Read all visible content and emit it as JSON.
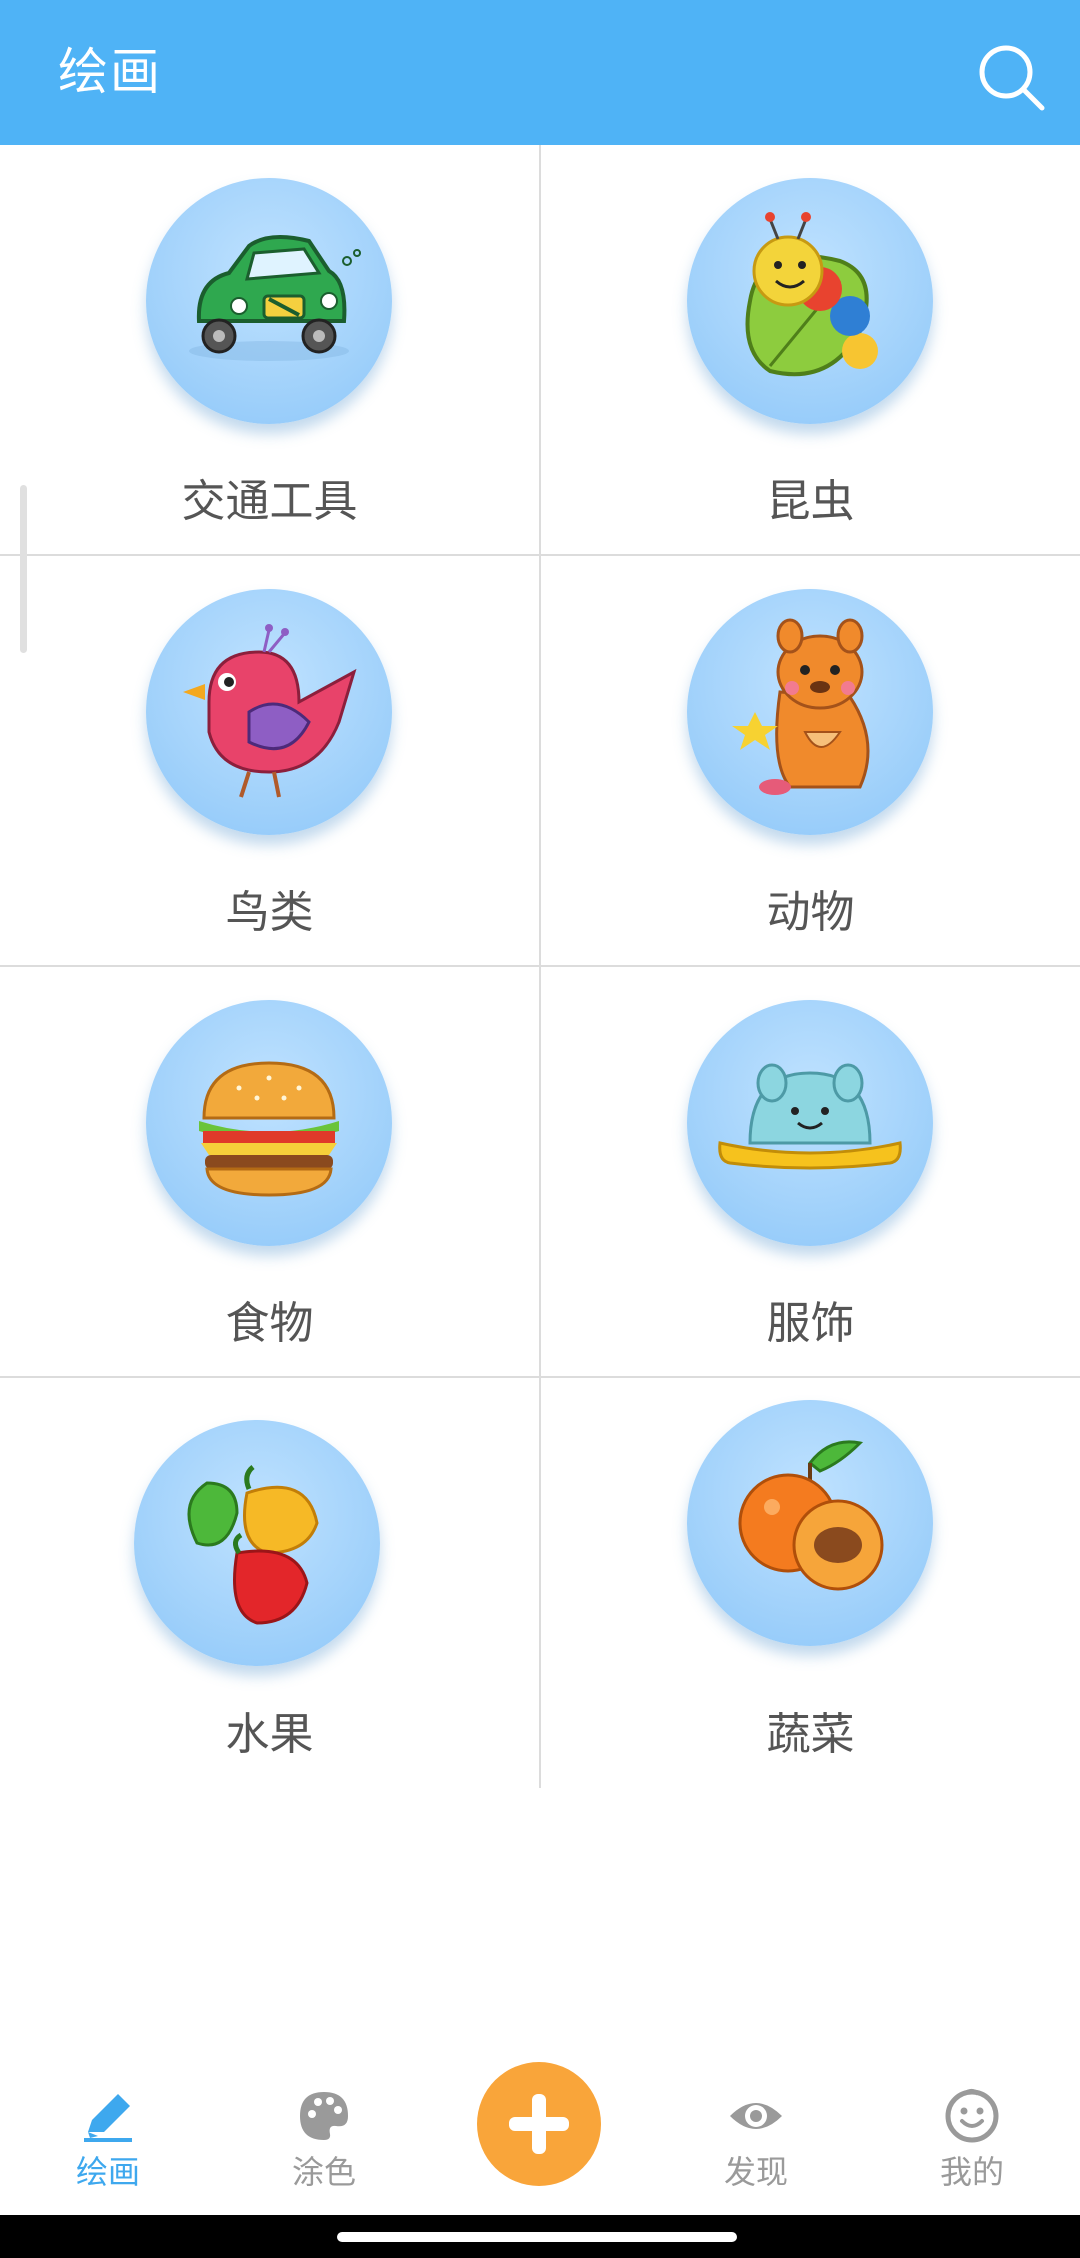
{
  "header": {
    "title": "绘画",
    "search_icon": "search-icon",
    "background_color": "#4fb3f6"
  },
  "categories": [
    {
      "label": "交通工具",
      "icon": "car-icon"
    },
    {
      "label": "昆虫",
      "icon": "caterpillar-icon"
    },
    {
      "label": "鸟类",
      "icon": "bird-icon"
    },
    {
      "label": "动物",
      "icon": "kangaroo-icon"
    },
    {
      "label": "食物",
      "icon": "hamburger-icon"
    },
    {
      "label": "服饰",
      "icon": "hat-icon"
    },
    {
      "label": "水果",
      "icon": "peppers-icon"
    },
    {
      "label": "蔬菜",
      "icon": "apricot-icon"
    }
  ],
  "bottom_nav": {
    "items": [
      {
        "label": "绘画",
        "icon": "pencil-icon",
        "active": true
      },
      {
        "label": "涂色",
        "icon": "palette-icon",
        "active": false
      },
      {
        "label": "发现",
        "icon": "eye-icon",
        "active": false
      },
      {
        "label": "我的",
        "icon": "smiley-face-icon",
        "active": false
      }
    ],
    "fab_icon": "plus-icon",
    "active_color": "#3ea8ee",
    "inactive_color": "#9a9a9a",
    "fab_color": "#f9a53a"
  }
}
